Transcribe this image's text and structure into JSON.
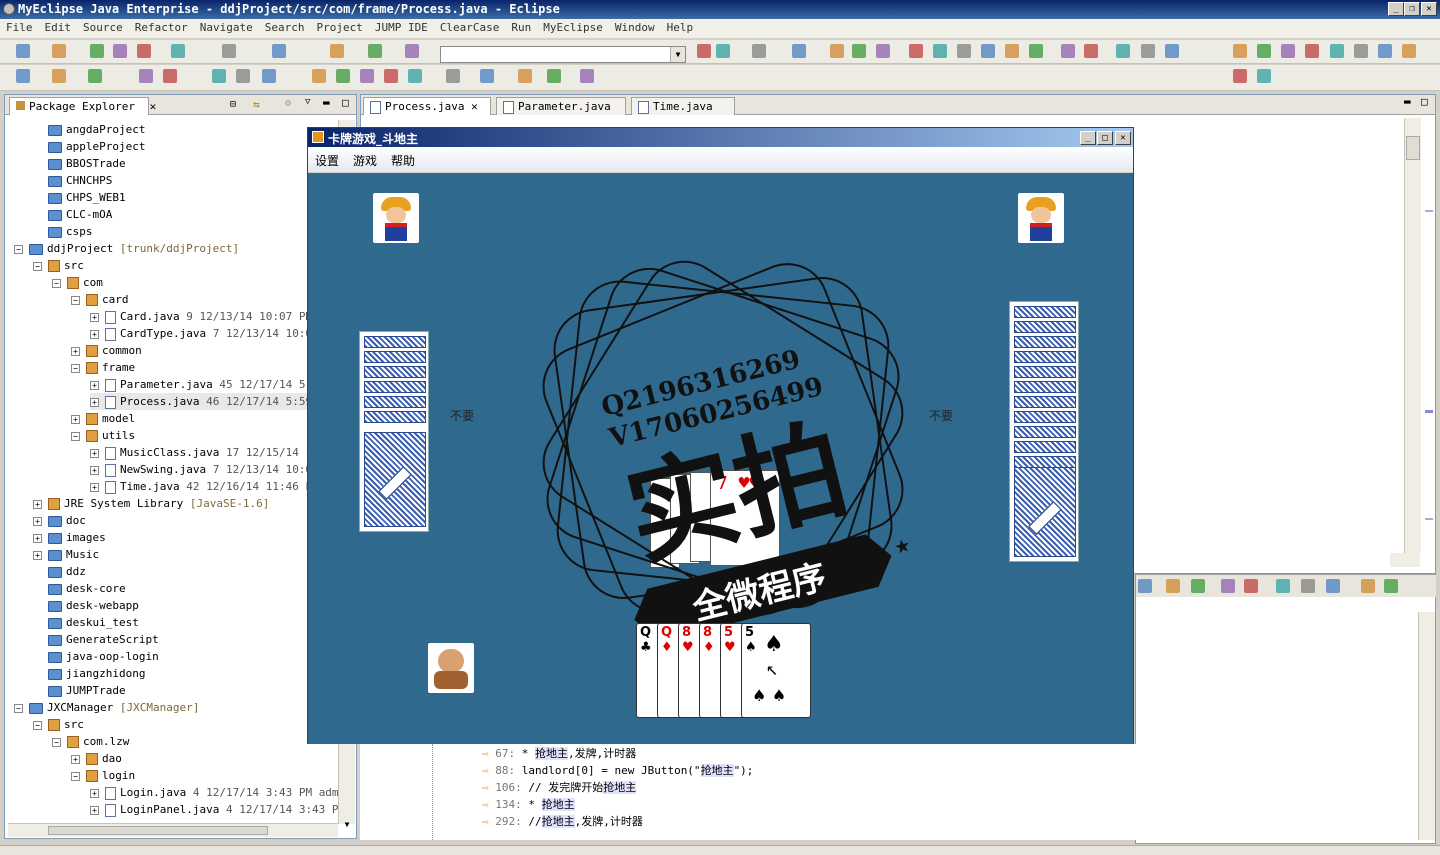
{
  "window": {
    "title": "MyEclipse Java Enterprise - ddjProject/src/com/frame/Process.java - Eclipse"
  },
  "menu": [
    "File",
    "Edit",
    "Source",
    "Refactor",
    "Navigate",
    "Search",
    "Project",
    "JUMP IDE",
    "ClearCase",
    "Run",
    "MyEclipse",
    "Window",
    "Help"
  ],
  "explorer": {
    "tab": "Package Explorer",
    "rows": [
      {
        "d": 1,
        "k": "folder",
        "t": "angdaProject"
      },
      {
        "d": 1,
        "k": "folder",
        "t": "appleProject"
      },
      {
        "d": 1,
        "k": "folder",
        "t": "BBOSTrade"
      },
      {
        "d": 1,
        "k": "folder",
        "t": "CHNCHPS"
      },
      {
        "d": 1,
        "k": "folder",
        "t": "CHPS_WEB1"
      },
      {
        "d": 1,
        "k": "folder",
        "t": "CLC-mOA"
      },
      {
        "d": 1,
        "k": "folder",
        "t": "csps"
      },
      {
        "d": 0,
        "e": "-",
        "k": "folder",
        "t": "ddjProject",
        "x": "[trunk/ddjProject]"
      },
      {
        "d": 1,
        "e": "-",
        "k": "pkg",
        "t": "src"
      },
      {
        "d": 2,
        "e": "-",
        "k": "pkg",
        "t": "com"
      },
      {
        "d": 3,
        "e": "-",
        "k": "pkg",
        "t": "card"
      },
      {
        "d": 4,
        "e": "+",
        "k": "jfile",
        "t": "Card.java",
        "x": "9  12/13/14 10:07 PM"
      },
      {
        "d": 4,
        "e": "+",
        "k": "jfile",
        "t": "CardType.java",
        "x": "7  12/13/14 10:0"
      },
      {
        "d": 3,
        "e": "+",
        "k": "pkg",
        "t": "common"
      },
      {
        "d": 3,
        "e": "-",
        "k": "pkg",
        "t": "frame"
      },
      {
        "d": 4,
        "e": "+",
        "k": "jfile",
        "t": "Parameter.java",
        "x": "45  12/17/14 5:"
      },
      {
        "d": 4,
        "e": "+",
        "k": "jfile",
        "t": "Process.java",
        "x": "46  12/17/14 5:59",
        "sel": true
      },
      {
        "d": 3,
        "e": "+",
        "k": "pkg",
        "t": "model"
      },
      {
        "d": 3,
        "e": "-",
        "k": "pkg",
        "t": "utils"
      },
      {
        "d": 4,
        "e": "+",
        "k": "jfile",
        "t": "MusicClass.java",
        "x": "17  12/15/14 1"
      },
      {
        "d": 4,
        "e": "+",
        "k": "jfile",
        "t": "NewSwing.java",
        "x": "7  12/13/14 10:0"
      },
      {
        "d": 4,
        "e": "+",
        "k": "jfile",
        "t": "Time.java",
        "x": "42  12/16/14 11:46 P"
      },
      {
        "d": 1,
        "e": "+",
        "k": "pkg",
        "t": "JRE System Library",
        "x": "[JavaSE-1.6]"
      },
      {
        "d": 1,
        "e": "+",
        "k": "folder",
        "t": "doc"
      },
      {
        "d": 1,
        "e": "+",
        "k": "folder",
        "t": "images"
      },
      {
        "d": 1,
        "e": "+",
        "k": "folder",
        "t": "Music"
      },
      {
        "d": 1,
        "k": "folder",
        "t": "ddz"
      },
      {
        "d": 1,
        "k": "folder",
        "t": "desk-core"
      },
      {
        "d": 1,
        "k": "folder",
        "t": "desk-webapp"
      },
      {
        "d": 1,
        "k": "folder",
        "t": "deskui_test"
      },
      {
        "d": 1,
        "k": "folder",
        "t": "GenerateScript"
      },
      {
        "d": 1,
        "k": "folder",
        "t": "java-oop-login"
      },
      {
        "d": 1,
        "k": "folder",
        "t": "jiangzhidong"
      },
      {
        "d": 1,
        "k": "folder",
        "t": "JUMPTrade"
      },
      {
        "d": 0,
        "e": "-",
        "k": "folder",
        "t": "JXCManager",
        "x": "[JXCManager]"
      },
      {
        "d": 1,
        "e": "-",
        "k": "pkg",
        "t": "src"
      },
      {
        "d": 2,
        "e": "-",
        "k": "pkg",
        "t": "com.lzw"
      },
      {
        "d": 3,
        "e": "+",
        "k": "pkg",
        "t": "dao"
      },
      {
        "d": 3,
        "e": "-",
        "k": "pkg",
        "t": "login"
      },
      {
        "d": 4,
        "e": "+",
        "k": "jfile",
        "t": "Login.java",
        "x": "4  12/17/14 3:43 PM  admi"
      },
      {
        "d": 4,
        "e": "+",
        "k": "jfile",
        "t": "LoginPanel.java",
        "x": "4  12/17/14 3:43 PM"
      }
    ]
  },
  "editor": {
    "tabs": [
      "Process.java",
      "Parameter.java",
      "Time.java"
    ]
  },
  "game": {
    "title": "卡牌游戏_斗地主",
    "menu": [
      "设置",
      "游戏",
      "帮助"
    ],
    "pass_left": "不要",
    "pass_right": "不要",
    "watermark": {
      "line1": "Q2196316269",
      "line2": "V17060256499",
      "big": "实拍",
      "banner": "全微程序"
    },
    "hand": [
      "Q",
      "Q",
      "8",
      "8",
      "5",
      "5"
    ]
  },
  "search": {
    "rows": [
      {
        "n": "67:",
        "c": " * ",
        "h": "抢地主",
        "r": ",发牌,计时器"
      },
      {
        "n": "88:",
        "c": " landlord[0] = new JButton(\"",
        "h": "抢地主",
        "r": "\");"
      },
      {
        "n": "106:",
        "c": " // 发完牌开始",
        "h": "抢地主",
        "r": ""
      },
      {
        "n": "134:",
        "c": " * ",
        "h": "抢地主",
        "r": ""
      },
      {
        "n": "292:",
        "c": " //",
        "h": "抢地主",
        "r": ",发牌,计时器"
      }
    ]
  }
}
